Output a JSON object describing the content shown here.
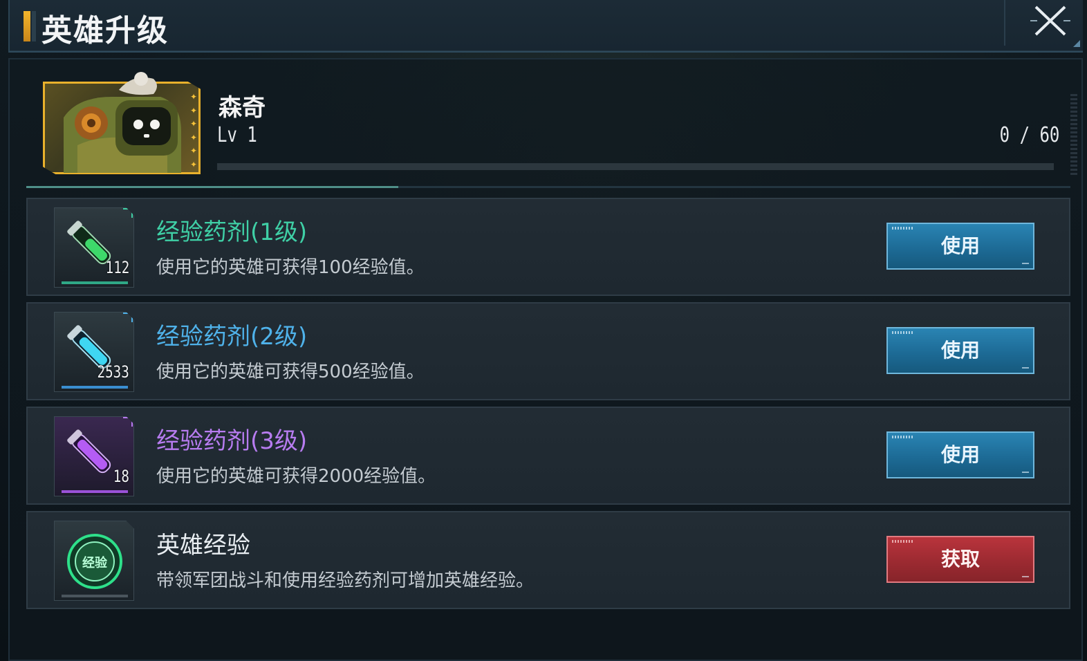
{
  "header": {
    "title": "英雄升级"
  },
  "hero": {
    "name": "森奇",
    "level": "Lv 1",
    "exp_text": "0 / 60",
    "exp_progress": 0,
    "stars": 6
  },
  "items": [
    {
      "title": "经验药剂(1级)",
      "desc": "使用它的英雄可获得100经验值。",
      "count": "112",
      "button": "使用",
      "color": "#3fd0a6",
      "tube": "#3ed86a"
    },
    {
      "title": "经验药剂(2级)",
      "desc": "使用它的英雄可获得500经验值。",
      "count": "2533",
      "button": "使用",
      "color": "#4fb2ea",
      "tube": "#3fd6f2"
    },
    {
      "title": "经验药剂(3级)",
      "desc": "使用它的英雄可获得2000经验值。",
      "count": "18",
      "button": "使用",
      "color": "#b77cf0",
      "tube": "#b45cf4"
    },
    {
      "title": "英雄经验",
      "desc": "带领军团战斗和使用经验药剂可增加英雄经验。",
      "button": "获取",
      "color": "#e9eef2",
      "badge": "经验"
    }
  ],
  "colors": {
    "accent": "#f2b52c",
    "button_blue": "#1d6b96",
    "button_red": "#9c2a31"
  },
  "icons": {
    "close": "close-icon",
    "potion": "potion-icon",
    "exp_badge": "exp-badge-icon"
  }
}
